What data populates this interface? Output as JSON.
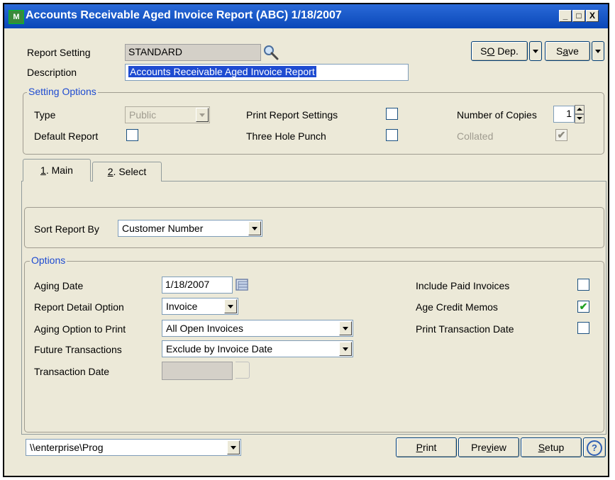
{
  "window": {
    "title": "Accounts Receivable Aged Invoice Report (ABC) 1/18/2007",
    "app_icon_text": "M",
    "minimize": "_",
    "maximize": "□",
    "close": "X"
  },
  "header": {
    "report_setting_label": "Report Setting",
    "report_setting_value": "STANDARD",
    "description_label": "Description",
    "description_value": "Accounts Receivable Aged Invoice Report",
    "so_dep_label_pre": "S",
    "so_dep_label_ul": "O",
    "so_dep_label_post": " Dep.",
    "save_label_pre": "S",
    "save_label_ul": "a",
    "save_label_post": "ve"
  },
  "setting_options": {
    "group_title": "Setting Options",
    "type_label": "Type",
    "type_value": "Public",
    "default_report_label": "Default Report",
    "default_report_checked": false,
    "print_report_settings_label": "Print Report Settings",
    "print_report_settings_checked": false,
    "three_hole_punch_label": "Three Hole Punch",
    "three_hole_punch_checked": false,
    "number_of_copies_label": "Number of Copies",
    "number_of_copies_value": "1",
    "collated_label": "Collated",
    "collated_checked": true
  },
  "tabs": [
    {
      "ul": "1",
      "rest": ". Main",
      "active": true
    },
    {
      "ul": "2",
      "rest": ". Select",
      "active": false
    }
  ],
  "main": {
    "sort_report_by_label": "Sort Report By",
    "sort_report_by_value": "Customer Number",
    "options_group_title": "Options",
    "aging_date_label": "Aging Date",
    "aging_date_value": "1/18/2007",
    "report_detail_option_label": "Report Detail Option",
    "report_detail_option_value": "Invoice",
    "aging_option_label": "Aging Option to Print",
    "aging_option_value": "All Open Invoices",
    "future_transactions_label": "Future Transactions",
    "future_transactions_value": "Exclude by Invoice Date",
    "transaction_date_label": "Transaction Date",
    "transaction_date_value": "",
    "include_paid_invoices_label": "Include Paid Invoices",
    "include_paid_invoices_checked": false,
    "age_credit_memos_label": "Age Credit Memos",
    "age_credit_memos_checked": true,
    "print_transaction_date_label": "Print Transaction Date",
    "print_transaction_date_checked": false
  },
  "footer": {
    "printer_value": "\\\\enterprise\\Prog",
    "print_ul": "P",
    "print_rest": "rint",
    "preview_pre": "Pre",
    "preview_ul": "v",
    "preview_post": "iew",
    "setup_ul": "S",
    "setup_rest": "etup",
    "help_glyph": "?"
  },
  "glyphs": {
    "check": "✔"
  }
}
